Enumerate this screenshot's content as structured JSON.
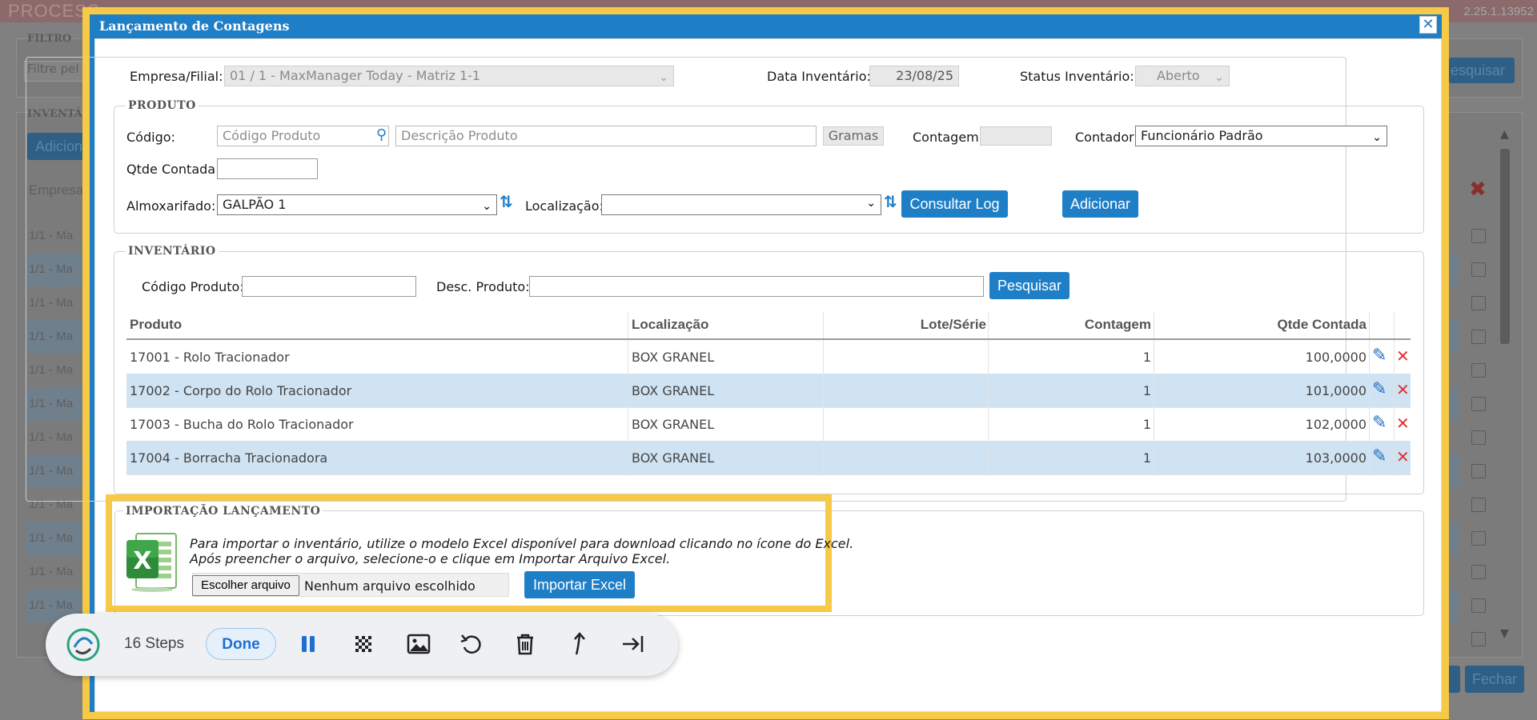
{
  "background": {
    "app_title": "PROCESS",
    "version": "2.25.1.13952",
    "filter_legend": "FILTRO",
    "filter_placeholder": "Filtre pel",
    "search_button": "esquisar",
    "inventory_legend": "INVENTÁ",
    "add_button": "Adicion",
    "company_header": "Empresa",
    "row_label": "1/1 - Ma",
    "close_button": "Fechar"
  },
  "modal": {
    "title": "Lançamento de Contagens",
    "close_label": "✕",
    "empresa_label": "Empresa/Filial:",
    "empresa_value": "01 / 1 - MaxManager Today - Matriz 1-1",
    "data_label": "Data Inventário:",
    "data_value": "23/08/25",
    "status_label": "Status Inventário:",
    "status_value": "Aberto"
  },
  "produto": {
    "legend": "PRODUTO",
    "codigo_label": "Código:",
    "codigo_placeholder": "Código Produto",
    "descricao_placeholder": "Descrição Produto",
    "unit": "Gramas",
    "contagem_label": "Contagem:",
    "contador_label": "Contador:",
    "contador_value": "Funcionário Padrão",
    "qtde_label": "Qtde Contada:",
    "almox_label": "Almoxarifado:",
    "almox_value": "GALPÃO 1",
    "localizacao_label": "Localização:",
    "consultar_button": "Consultar Log",
    "adicionar_button": "Adicionar"
  },
  "inventario": {
    "legend": "INVENTÁRIO",
    "codigo_label": "Código Produto:",
    "desc_label": "Desc. Produto:",
    "pesquisar_button": "Pesquisar",
    "columns": [
      "Produto",
      "Localização",
      "Lote/Série",
      "Contagem",
      "Qtde Contada"
    ],
    "rows": [
      {
        "produto": "17001 - Rolo Tracionador",
        "localizacao": "BOX GRANEL",
        "lote": "",
        "contagem": "1",
        "qtde": "100,0000"
      },
      {
        "produto": "17002 - Corpo do Rolo Tracionador",
        "localizacao": "BOX GRANEL",
        "lote": "",
        "contagem": "1",
        "qtde": "101,0000"
      },
      {
        "produto": "17003 - Bucha do Rolo Tracionador",
        "localizacao": "BOX GRANEL",
        "lote": "",
        "contagem": "1",
        "qtde": "102,0000"
      },
      {
        "produto": "17004 - Borracha Tracionadora",
        "localizacao": "BOX GRANEL",
        "lote": "",
        "contagem": "1",
        "qtde": "103,0000"
      }
    ]
  },
  "importacao": {
    "legend": "IMPORTAÇÃO LANÇAMENTO",
    "line1": "Para importar o inventário, utilize o modelo Excel disponível para download clicando no ícone do Excel.",
    "line2": "Após preencher o arquivo, selecione-o e clique em Importar Arquivo Excel.",
    "file_button": "Escolher arquivo",
    "file_status": "Nenhum arquivo escolhido",
    "import_button": "Importar Excel"
  },
  "toolbar": {
    "steps": "16 Steps",
    "done": "Done",
    "icons": [
      "pause-icon",
      "blur-icon",
      "image-icon",
      "undo-icon",
      "trash-icon",
      "up-arrow-icon",
      "skip-end-icon"
    ]
  },
  "colors": {
    "accent": "#1f7fc6",
    "highlight": "#f6c946",
    "row_alt": "#cfe3f3",
    "delete": "#e03131"
  }
}
